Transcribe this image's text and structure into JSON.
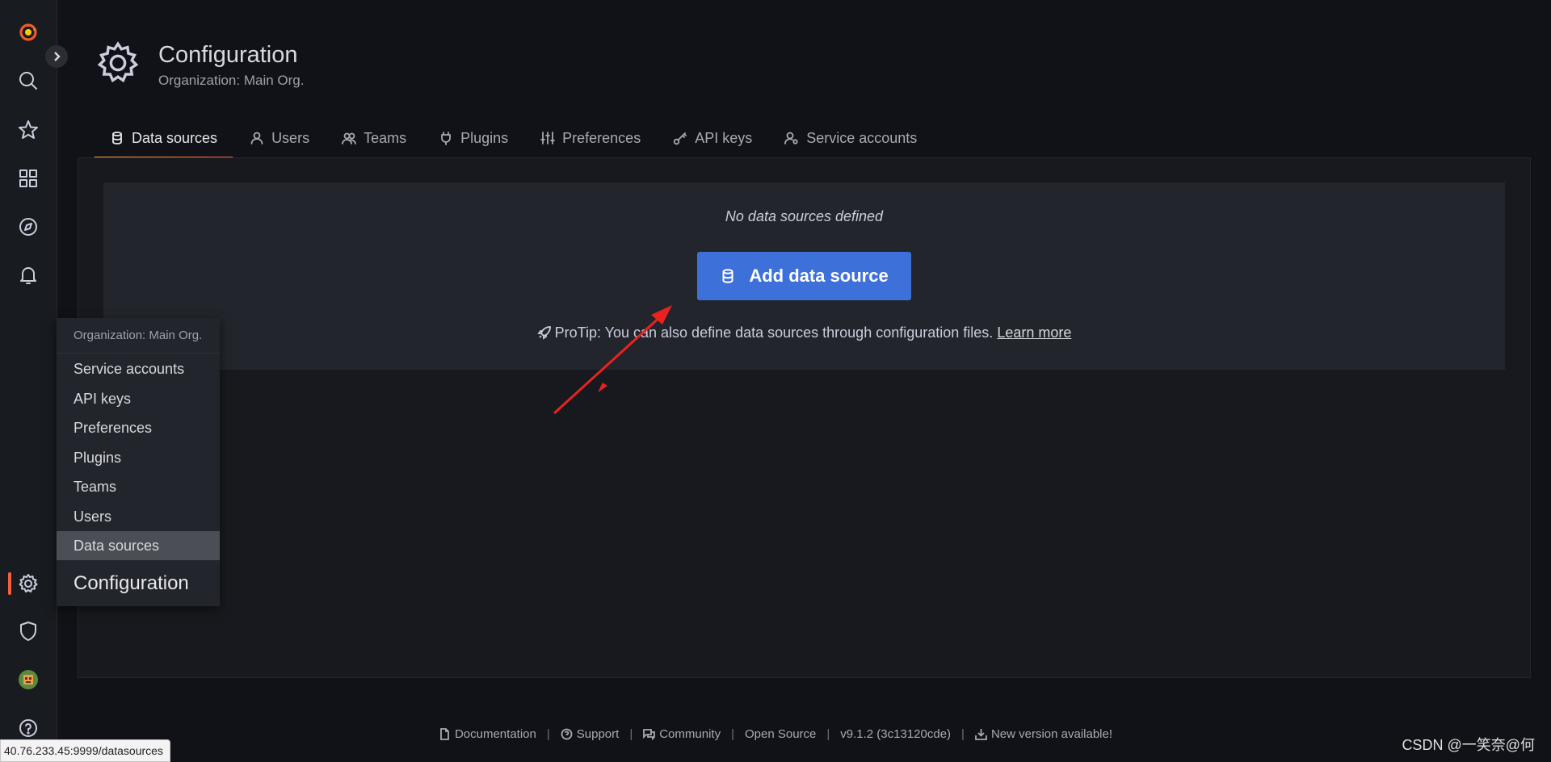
{
  "sidebar": {
    "items": [
      {
        "name": "logo-icon"
      },
      {
        "name": "search-icon"
      },
      {
        "name": "star-icon"
      },
      {
        "name": "dashboards-icon"
      },
      {
        "name": "explore-icon"
      },
      {
        "name": "alerting-icon"
      },
      {
        "name": "gear-icon"
      },
      {
        "name": "shield-icon"
      },
      {
        "name": "avatar-icon"
      },
      {
        "name": "help-icon"
      }
    ],
    "active_color": "#f55f3e"
  },
  "header": {
    "title": "Configuration",
    "subtitle": "Organization: Main Org."
  },
  "tabs": [
    {
      "label": "Data sources",
      "icon": "database-icon",
      "active": true
    },
    {
      "label": "Users",
      "icon": "user-icon"
    },
    {
      "label": "Teams",
      "icon": "users-icon"
    },
    {
      "label": "Plugins",
      "icon": "plug-icon"
    },
    {
      "label": "Preferences",
      "icon": "sliders-icon"
    },
    {
      "label": "API keys",
      "icon": "key-icon"
    },
    {
      "label": "Service accounts",
      "icon": "user-cog-icon"
    }
  ],
  "empty_state": {
    "message": "No data sources defined",
    "button_label": "Add data source",
    "protip_text": "ProTip: You can also define data sources through configuration files.",
    "learn_more": "Learn more",
    "button_color": "#3d71d9"
  },
  "menu": {
    "header": "Organization: Main Org.",
    "items": [
      "Service accounts",
      "API keys",
      "Preferences",
      "Plugins",
      "Teams",
      "Users",
      "Data sources"
    ],
    "selected": "Data sources",
    "footer": "Configuration"
  },
  "footer": {
    "documentation": "Documentation",
    "support": "Support",
    "community": "Community",
    "open_source": "Open Source",
    "version": "v9.1.2 (3c13120cde)",
    "new_version": "New version available!",
    "separator": "|"
  },
  "status_url": "40.76.233.45:9999/datasources",
  "watermark": "CSDN @\u0002一笑奈@何"
}
